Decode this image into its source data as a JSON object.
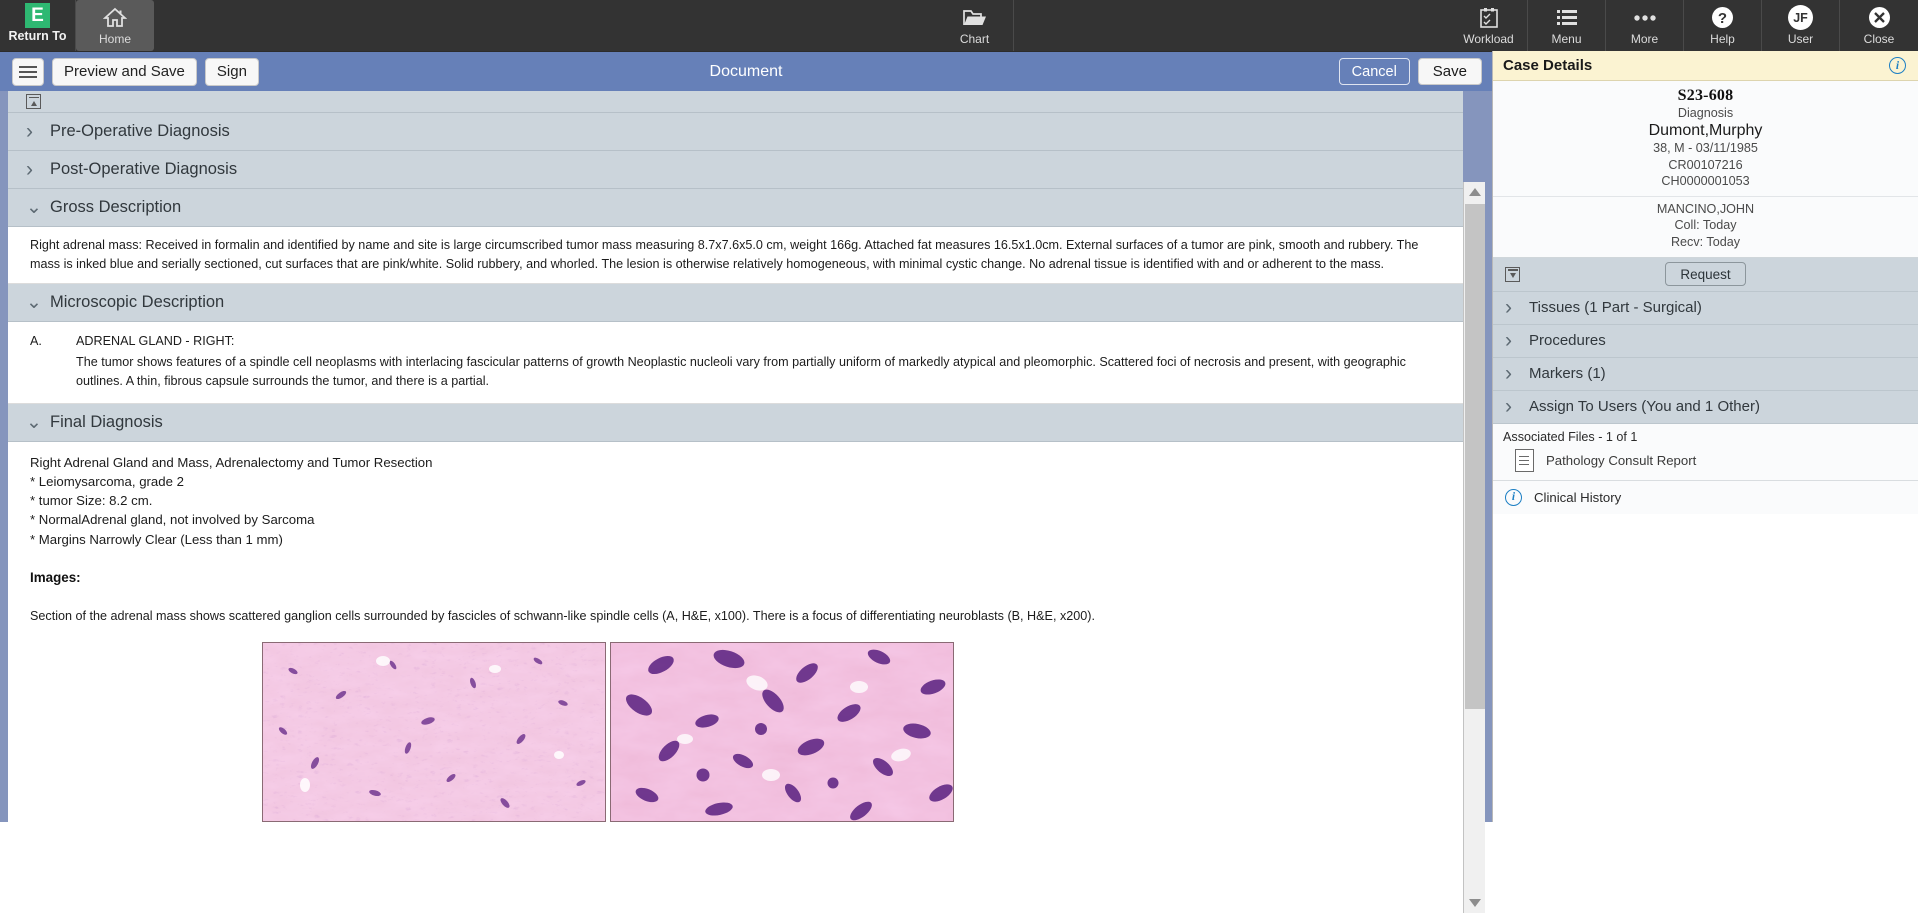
{
  "topbar": {
    "return_to_label": "Return To",
    "logo_letter": "E",
    "home_label": "Home",
    "chart_label": "Chart",
    "workload_label": "Workload",
    "menu_label": "Menu",
    "more_label": "More",
    "help_label": "Help",
    "user_label": "User",
    "user_initials": "JF",
    "close_label": "Close"
  },
  "docbar": {
    "preview_and_save": "Preview and Save",
    "sign": "Sign",
    "title": "Document",
    "cancel": "Cancel",
    "save": "Save"
  },
  "document": {
    "sections": [
      {
        "label": "Pre-Operative Diagnosis",
        "expanded": false
      },
      {
        "label": "Post-Operative Diagnosis",
        "expanded": false
      },
      {
        "label": "Gross Description",
        "expanded": true
      },
      {
        "label": "Microscopic Description",
        "expanded": true
      },
      {
        "label": "Final Diagnosis",
        "expanded": true
      }
    ],
    "gross_description": "Right adrenal mass: Received in formalin and identified by name and site is large circumscribed tumor mass measuring 8.7x7.6x5.0 cm, weight 166g. Attached fat measures 16.5x1.0cm. External surfaces of a tumor are pink, smooth and rubbery. The mass is inked blue and serially sectioned, cut surfaces that are pink/white. Solid rubbery, and whorled. The lesion is otherwise relatively homogeneous, with minimal cystic change. No adrenal tissue is identified with and or adherent to the mass.",
    "microscopic": {
      "letter": "A.",
      "title": "ADRENAL GLAND - RIGHT:",
      "text": "The tumor shows features of a spindle cell neoplasms with interlacing fascicular patterns of growth Neoplastic nucleoli vary from partially uniform of markedly atypical and pleomorphic. Scattered foci of necrosis and present, with geographic outlines. A thin, fibrous capsule surrounds the tumor, and there is a partial."
    },
    "final_diagnosis": {
      "lines": [
        "Right Adrenal Gland and Mass, Adrenalectomy and Tumor Resection",
        "* Leiomysarcoma, grade 2",
        "* tumor Size: 8.2 cm.",
        "* NormalAdrenal gland, not involved by Sarcoma",
        "* Margins Narrowly Clear (Less than 1 mm)"
      ],
      "images_label": "Images:",
      "images_caption": "Section of the adrenal mass shows scattered ganglion cells surrounded by fascicles of schwann-like spindle cells (A, H&E, x100). There is a focus of differentiating neuroblasts (B, H&E, x200)."
    }
  },
  "case_details": {
    "panel_title": "Case Details",
    "case_id": "S23-608",
    "case_type": "Diagnosis",
    "patient_name": "Dumont,Murphy",
    "patient_demo": "38, M - 03/11/1985",
    "cr_number": "CR00107216",
    "ch_number": "CH0000001053",
    "physician": "MANCINO,JOHN",
    "collected": "Coll: Today",
    "received": "Recv: Today",
    "request_button": "Request",
    "sections": [
      "Tissues (1 Part - Surgical)",
      "Procedures",
      "Markers (1)",
      "Assign To Users (You and 1 Other)"
    ],
    "associated_files_header": "Associated Files - 1 of 1",
    "associated_file": "Pathology Consult Report",
    "clinical_history": "Clinical History"
  },
  "colors": {
    "topbar_bg": "#333333",
    "docbar_blue": "#6680b8",
    "section_header": "#ccd5dc",
    "panel_header_yellow": "#fbf3d2",
    "accent_blue": "#1c7fc4",
    "logo_green": "#2eb872"
  }
}
